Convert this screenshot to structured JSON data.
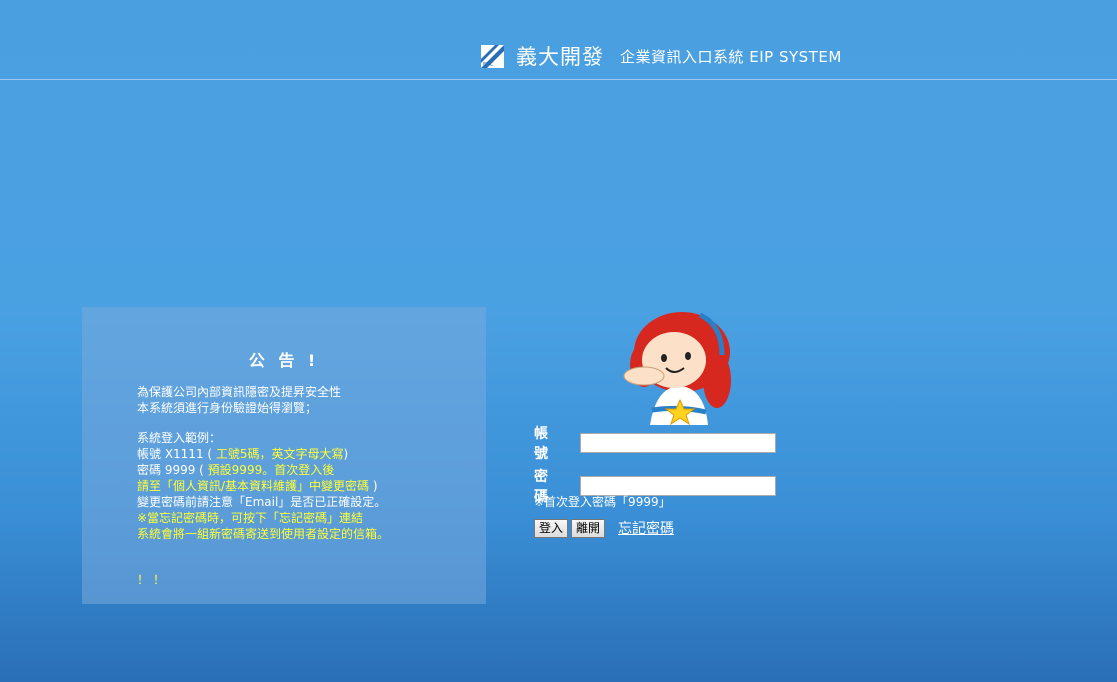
{
  "header": {
    "logo_mark_text": "EDC",
    "company_name": "義大開發",
    "system_name": "企業資訊入口系統  EIP SYSTEM"
  },
  "notice": {
    "title": "公 告 !",
    "lines": [
      "為保護公司內部資訊隱密及提昇安全性",
      "本系統須進行身份驗證始得瀏覽；"
    ],
    "example_title": "系統登入範例：",
    "account_example_prefix": "帳號 X1111 (",
    "account_example_note": " 工號5碼，英文字母大寫",
    "account_example_suffix": ")",
    "password_example_prefix": "密碼 9999 (",
    "password_example_note": " 預設9999。首次登入後",
    "change_pw_line": "請至「個人資訊/基本資料維護」中變更密碼",
    "change_pw_suffix": " )",
    "email_line": "變更密碼前請注意「Email」是否已正確設定。",
    "forgot_line_1": "※當忘記密碼時，可按下「忘記密碼」連結",
    "forgot_line_2": "系統會將一組新密碼寄送到使用者設定的信箱。",
    "end_mark": "！！"
  },
  "login": {
    "account_label": "帳 號",
    "account_value": "",
    "password_label": "密 碼",
    "password_value": "",
    "hint": "※首次登入密碼「9999」",
    "login_button": "登入",
    "leave_button": "離開",
    "forgot_link": "忘記密碼"
  },
  "colors": {
    "highlight": "#ffff33",
    "background_top": "#4a9fe0",
    "background_bottom": "#2a6fb7"
  }
}
